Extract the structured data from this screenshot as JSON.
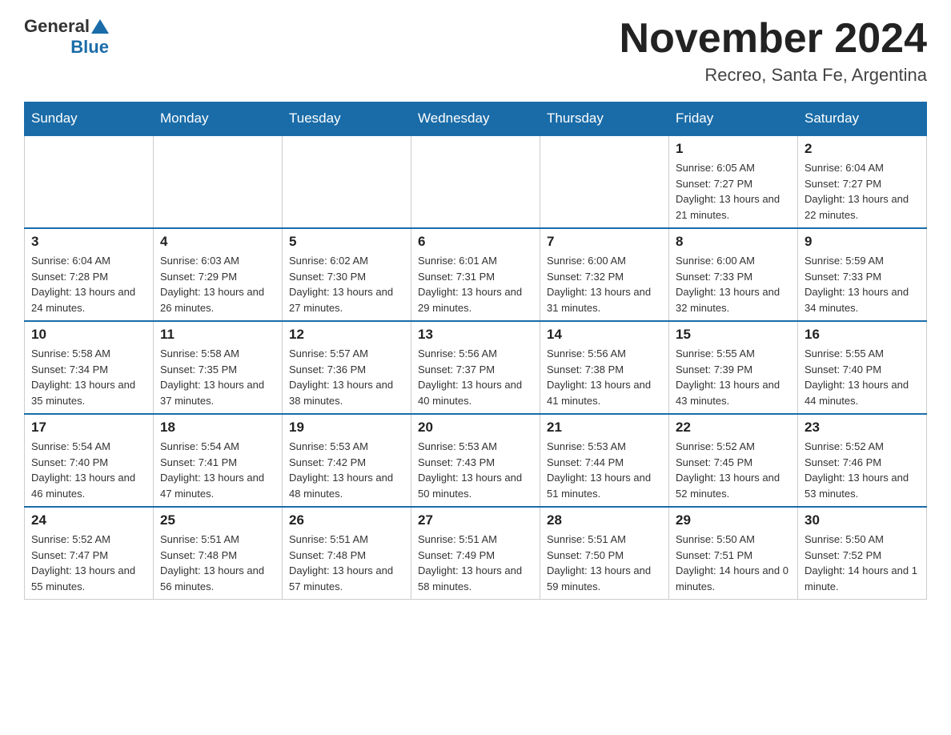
{
  "header": {
    "month_title": "November 2024",
    "subtitle": "Recreo, Santa Fe, Argentina"
  },
  "logo": {
    "general": "General",
    "blue": "Blue"
  },
  "days_of_week": [
    "Sunday",
    "Monday",
    "Tuesday",
    "Wednesday",
    "Thursday",
    "Friday",
    "Saturday"
  ],
  "weeks": [
    [
      {
        "day": "",
        "info": ""
      },
      {
        "day": "",
        "info": ""
      },
      {
        "day": "",
        "info": ""
      },
      {
        "day": "",
        "info": ""
      },
      {
        "day": "",
        "info": ""
      },
      {
        "day": "1",
        "info": "Sunrise: 6:05 AM\nSunset: 7:27 PM\nDaylight: 13 hours and 21 minutes."
      },
      {
        "day": "2",
        "info": "Sunrise: 6:04 AM\nSunset: 7:27 PM\nDaylight: 13 hours and 22 minutes."
      }
    ],
    [
      {
        "day": "3",
        "info": "Sunrise: 6:04 AM\nSunset: 7:28 PM\nDaylight: 13 hours and 24 minutes."
      },
      {
        "day": "4",
        "info": "Sunrise: 6:03 AM\nSunset: 7:29 PM\nDaylight: 13 hours and 26 minutes."
      },
      {
        "day": "5",
        "info": "Sunrise: 6:02 AM\nSunset: 7:30 PM\nDaylight: 13 hours and 27 minutes."
      },
      {
        "day": "6",
        "info": "Sunrise: 6:01 AM\nSunset: 7:31 PM\nDaylight: 13 hours and 29 minutes."
      },
      {
        "day": "7",
        "info": "Sunrise: 6:00 AM\nSunset: 7:32 PM\nDaylight: 13 hours and 31 minutes."
      },
      {
        "day": "8",
        "info": "Sunrise: 6:00 AM\nSunset: 7:33 PM\nDaylight: 13 hours and 32 minutes."
      },
      {
        "day": "9",
        "info": "Sunrise: 5:59 AM\nSunset: 7:33 PM\nDaylight: 13 hours and 34 minutes."
      }
    ],
    [
      {
        "day": "10",
        "info": "Sunrise: 5:58 AM\nSunset: 7:34 PM\nDaylight: 13 hours and 35 minutes."
      },
      {
        "day": "11",
        "info": "Sunrise: 5:58 AM\nSunset: 7:35 PM\nDaylight: 13 hours and 37 minutes."
      },
      {
        "day": "12",
        "info": "Sunrise: 5:57 AM\nSunset: 7:36 PM\nDaylight: 13 hours and 38 minutes."
      },
      {
        "day": "13",
        "info": "Sunrise: 5:56 AM\nSunset: 7:37 PM\nDaylight: 13 hours and 40 minutes."
      },
      {
        "day": "14",
        "info": "Sunrise: 5:56 AM\nSunset: 7:38 PM\nDaylight: 13 hours and 41 minutes."
      },
      {
        "day": "15",
        "info": "Sunrise: 5:55 AM\nSunset: 7:39 PM\nDaylight: 13 hours and 43 minutes."
      },
      {
        "day": "16",
        "info": "Sunrise: 5:55 AM\nSunset: 7:40 PM\nDaylight: 13 hours and 44 minutes."
      }
    ],
    [
      {
        "day": "17",
        "info": "Sunrise: 5:54 AM\nSunset: 7:40 PM\nDaylight: 13 hours and 46 minutes."
      },
      {
        "day": "18",
        "info": "Sunrise: 5:54 AM\nSunset: 7:41 PM\nDaylight: 13 hours and 47 minutes."
      },
      {
        "day": "19",
        "info": "Sunrise: 5:53 AM\nSunset: 7:42 PM\nDaylight: 13 hours and 48 minutes."
      },
      {
        "day": "20",
        "info": "Sunrise: 5:53 AM\nSunset: 7:43 PM\nDaylight: 13 hours and 50 minutes."
      },
      {
        "day": "21",
        "info": "Sunrise: 5:53 AM\nSunset: 7:44 PM\nDaylight: 13 hours and 51 minutes."
      },
      {
        "day": "22",
        "info": "Sunrise: 5:52 AM\nSunset: 7:45 PM\nDaylight: 13 hours and 52 minutes."
      },
      {
        "day": "23",
        "info": "Sunrise: 5:52 AM\nSunset: 7:46 PM\nDaylight: 13 hours and 53 minutes."
      }
    ],
    [
      {
        "day": "24",
        "info": "Sunrise: 5:52 AM\nSunset: 7:47 PM\nDaylight: 13 hours and 55 minutes."
      },
      {
        "day": "25",
        "info": "Sunrise: 5:51 AM\nSunset: 7:48 PM\nDaylight: 13 hours and 56 minutes."
      },
      {
        "day": "26",
        "info": "Sunrise: 5:51 AM\nSunset: 7:48 PM\nDaylight: 13 hours and 57 minutes."
      },
      {
        "day": "27",
        "info": "Sunrise: 5:51 AM\nSunset: 7:49 PM\nDaylight: 13 hours and 58 minutes."
      },
      {
        "day": "28",
        "info": "Sunrise: 5:51 AM\nSunset: 7:50 PM\nDaylight: 13 hours and 59 minutes."
      },
      {
        "day": "29",
        "info": "Sunrise: 5:50 AM\nSunset: 7:51 PM\nDaylight: 14 hours and 0 minutes."
      },
      {
        "day": "30",
        "info": "Sunrise: 5:50 AM\nSunset: 7:52 PM\nDaylight: 14 hours and 1 minute."
      }
    ]
  ]
}
